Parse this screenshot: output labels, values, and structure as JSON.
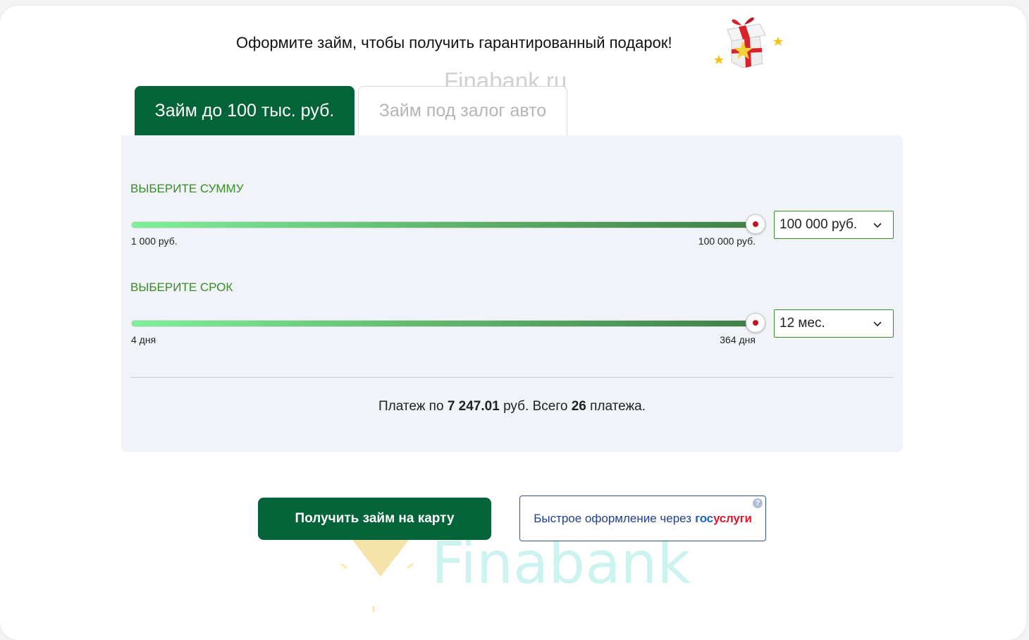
{
  "promo": {
    "text": "Оформите займ, чтобы получить гарантированный подарок!",
    "icon": "gift-box-icon"
  },
  "watermark": {
    "top_text": "Finabank.ru",
    "bottom_text": "Finabank",
    "logo_icon": "diamond-icon"
  },
  "tabs": [
    {
      "label": "Займ до 100 тыс. руб.",
      "active": true
    },
    {
      "label": "Займ под залог авто",
      "active": false
    }
  ],
  "amount": {
    "label": "ВЫБЕРИТЕ СУММУ",
    "min_label": "1 000 руб.",
    "max_label": "100 000 руб.",
    "selected": "100 000 руб.",
    "slider_fraction": 1.0
  },
  "term": {
    "label": "ВЫБЕРИТЕ СРОК",
    "min_label": "4 дня",
    "max_label": "364 дня",
    "selected": "12 мес.",
    "slider_fraction": 1.0
  },
  "summary": {
    "prefix": "Платеж по",
    "payment": "7 247.01",
    "middle": "руб. Всего",
    "count": "26",
    "suffix": "платежа."
  },
  "buttons": {
    "primary": "Получить займ на карту",
    "gosuslugi_text": "Быстрое оформление через",
    "gosuslugi_brand_a": "гос",
    "gosuslugi_brand_b": "услуги",
    "help": "?"
  },
  "colors": {
    "brand_green": "#03643a",
    "label_green": "#3a8a2a",
    "thumb_dot": "#c3101f",
    "gos_blue": "#1a66c0",
    "gos_red": "#e0192e"
  }
}
